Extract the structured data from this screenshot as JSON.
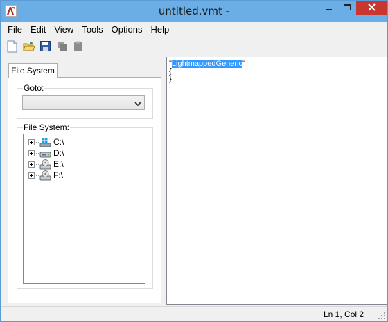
{
  "window": {
    "title": "untitled.vmt -",
    "accent_color": "#6aaee5",
    "close_color": "#c7362f"
  },
  "menu": [
    "File",
    "Edit",
    "View",
    "Tools",
    "Options",
    "Help"
  ],
  "toolbar": {
    "icons": [
      "new-file-icon",
      "open-folder-icon",
      "save-icon",
      "copy-icon",
      "paste-icon"
    ]
  },
  "left_panel": {
    "tab_label": "File System",
    "goto_label": "Goto:",
    "goto_value": "",
    "filesystem_label": "File System:",
    "drives": [
      {
        "label": "C:\\",
        "icon": "windows-drive-icon"
      },
      {
        "label": "D:\\",
        "icon": "hard-drive-icon"
      },
      {
        "label": "E:\\",
        "icon": "cd-drive-icon"
      },
      {
        "label": "F:\\",
        "icon": "cd-drive-icon"
      }
    ]
  },
  "editor": {
    "quote_open": "\"",
    "selected_text": "LightmappedGeneric",
    "quote_close": "\"",
    "line2": "{",
    "line3": "}"
  },
  "status": {
    "position": "Ln 1, Col 2"
  }
}
